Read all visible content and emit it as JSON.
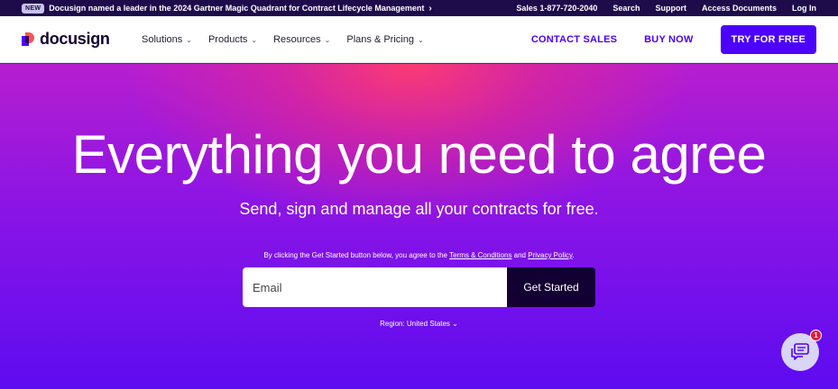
{
  "topbar": {
    "badge": "NEW",
    "announcement": "Docusign named a leader in the 2024 Gartner Magic Quadrant for Contract Lifecycle Management",
    "links": [
      "Sales 1-877-720-2040",
      "Search",
      "Support",
      "Access Documents",
      "Log In"
    ]
  },
  "nav": {
    "logo_text": "docusign",
    "menu": [
      "Solutions",
      "Products",
      "Resources",
      "Plans & Pricing"
    ],
    "contact_sales": "CONTACT SALES",
    "buy_now": "BUY NOW",
    "try_free": "TRY FOR FREE"
  },
  "hero": {
    "headline": "Everything you need to agree",
    "subhead": "Send, sign and manage all your contracts for free.",
    "legal_prefix": "By clicking the Get Started button below, you agree to the ",
    "legal_terms": "Terms & Conditions",
    "legal_and": " and ",
    "legal_privacy": "Privacy Policy",
    "legal_suffix": ".",
    "email_placeholder": "Email",
    "submit": "Get Started",
    "region": "Region: United States"
  },
  "chat": {
    "badge_count": "1",
    "icon": "chat-icon"
  },
  "colors": {
    "brand": "#4c00ff",
    "dark": "#130032",
    "badge": "#e0183a"
  }
}
